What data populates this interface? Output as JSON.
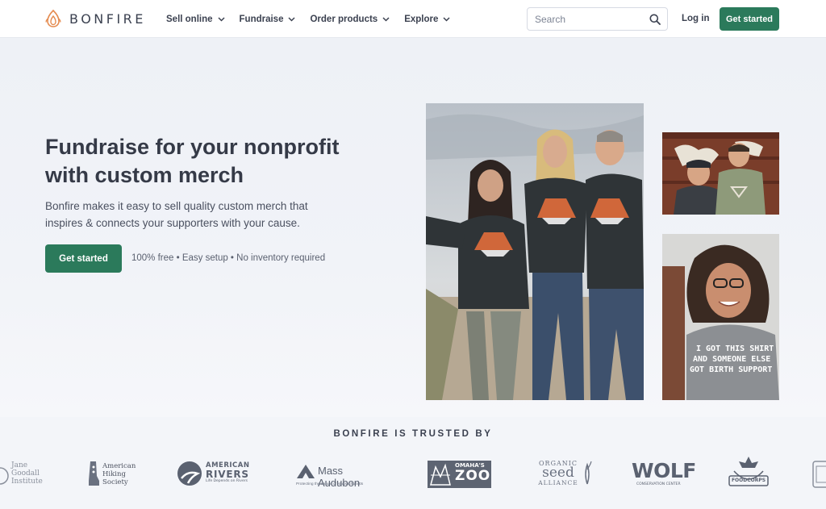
{
  "nav": {
    "brand": "BONFIRE",
    "menu": [
      {
        "label": "Sell online"
      },
      {
        "label": "Fundraise"
      },
      {
        "label": "Order products"
      },
      {
        "label": "Explore"
      }
    ],
    "search_placeholder": "Search",
    "login": "Log in",
    "cta": "Get started"
  },
  "hero": {
    "headline_line1": "Fundraise for your nonprofit",
    "headline_line2": "with custom merch",
    "subtext_line1": "Bonfire makes it easy to sell quality custom merch that",
    "subtext_line2": "inspires & connects your supporters with your cause.",
    "cta": "Get started",
    "perks": "100% free • Easy setup • No inventory required",
    "photo_shirt_text_line1": "I GOT THIS SHIRT",
    "photo_shirt_text_line2": "AND SOMEONE ELSE",
    "photo_shirt_text_line3": "GOT BIRTH SUPPORT"
  },
  "trusted": {
    "title": "BONFIRE IS TRUSTED BY",
    "logos": {
      "jane_line1": "Jane",
      "jane_line2": "Goodall",
      "jane_line3": "Institute",
      "hiking_line1": "American",
      "hiking_line2": "Hiking",
      "hiking_line3": "Society",
      "rivers_line1": "AMERICAN",
      "rivers_line2": "RIVERS",
      "rivers_tag": "Life Depends on Rivers",
      "audubon_name": "Mass Audubon",
      "audubon_tag": "Protecting the nature of Massachusetts",
      "zoo_line1": "OMAHA'S",
      "zoo_line2": "ZOO",
      "seed_line1": "ORGANIC",
      "seed_line2": "seed",
      "seed_line3": "ALLIANCE",
      "wolf_name": "WOLF",
      "wolf_tag": "CONSERVATION CENTER",
      "foodcorps": "FOODCORPS"
    }
  },
  "colors": {
    "brand_green": "#2b7a5b",
    "logo_orange": "#e58b4f",
    "text_dark": "#353a47"
  },
  "icons": {
    "logo": "flame-icon",
    "search": "search-icon",
    "dropdown": "chevron-down-icon"
  }
}
